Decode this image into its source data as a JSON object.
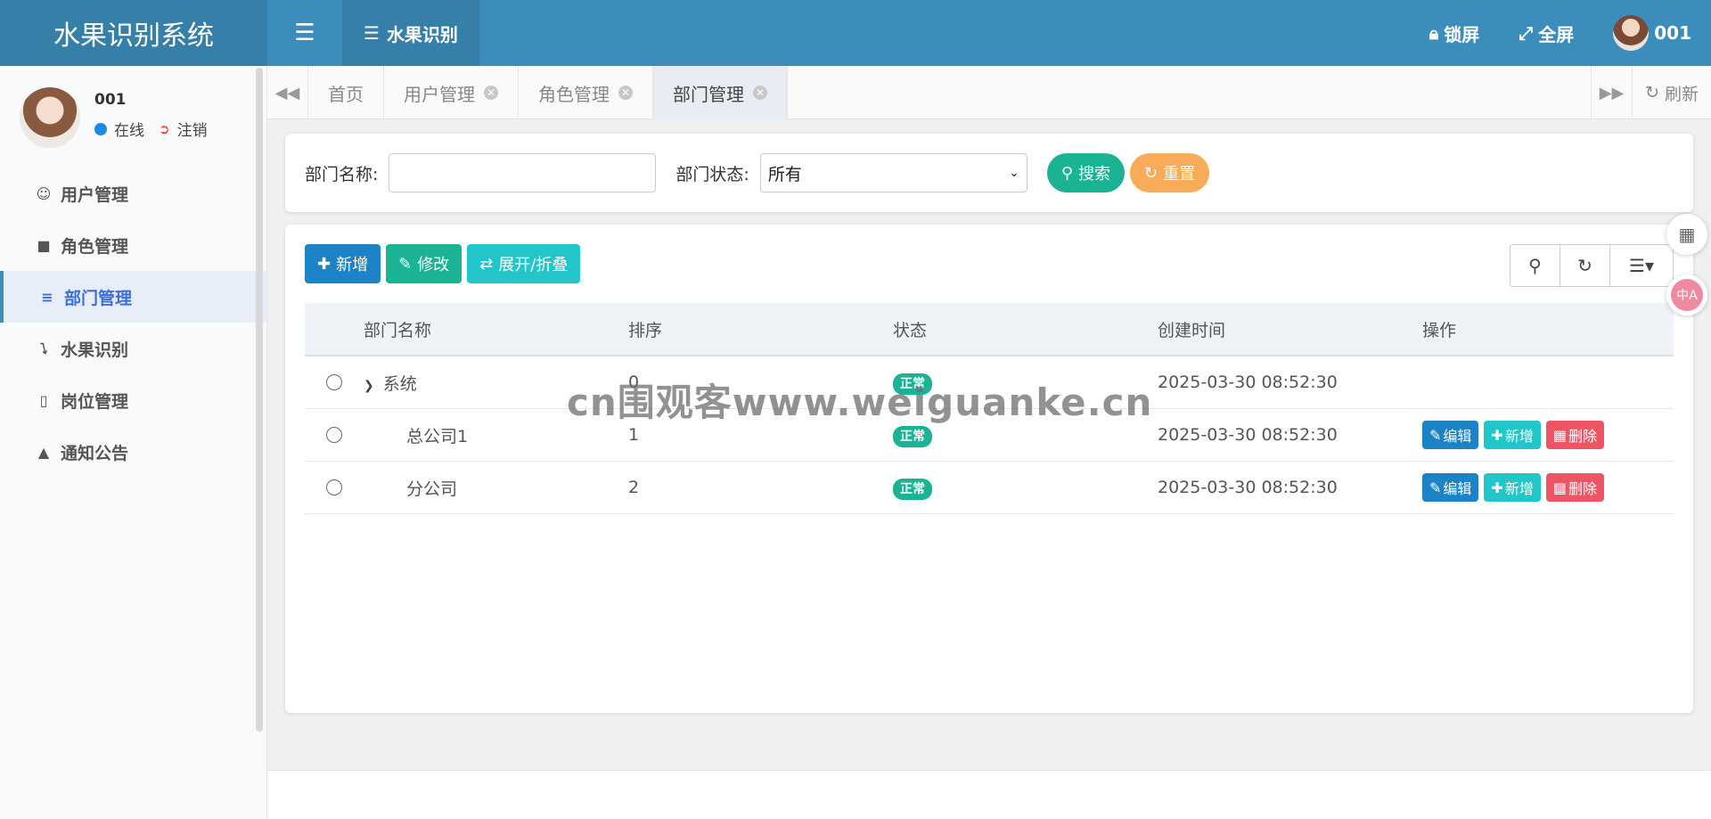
{
  "header": {
    "brand": "水果识别系统",
    "active_nav": "水果识别",
    "lock_label": "锁屏",
    "fullscreen_label": "全屏",
    "user": "001"
  },
  "sidebar": {
    "user_name": "001",
    "status": "在线",
    "logout": "注销",
    "items": [
      {
        "label": "用户管理",
        "icon": "user-icon"
      },
      {
        "label": "角色管理",
        "icon": "role-icon"
      },
      {
        "label": "部门管理",
        "icon": "list-indent-icon"
      },
      {
        "label": "水果识别",
        "icon": "bolt-icon"
      },
      {
        "label": "岗位管理",
        "icon": "id-card-icon"
      },
      {
        "label": "通知公告",
        "icon": "bullhorn-icon"
      }
    ]
  },
  "tabs": {
    "items": [
      {
        "label": "首页"
      },
      {
        "label": "用户管理"
      },
      {
        "label": "角色管理"
      },
      {
        "label": "部门管理"
      }
    ],
    "refresh": "刷新"
  },
  "search": {
    "dept_name_label": "部门名称:",
    "dept_name_value": "",
    "status_label": "部门状态:",
    "status_value": "所有",
    "search_btn": "搜索",
    "reset_btn": "重置"
  },
  "toolbar": {
    "add": "新增",
    "edit": "修改",
    "expand": "展开/折叠"
  },
  "table": {
    "headers": [
      "部门名称",
      "排序",
      "状态",
      "创建时间",
      "操作"
    ],
    "rows": [
      {
        "name": "系统",
        "order": "0",
        "status": "正常",
        "created": "2025-03-30 08:52:30"
      },
      {
        "name": "总公司1",
        "order": "1",
        "status": "正常",
        "created": "2025-03-30 08:52:30"
      },
      {
        "name": "分公司",
        "order": "2",
        "status": "正常",
        "created": "2025-03-30 08:52:30"
      }
    ],
    "actions": {
      "edit": "编辑",
      "add": "新增",
      "delete": "删除"
    }
  },
  "watermark": "cn围观客www.weiguanke.cn",
  "colors": {
    "header": "#3c8dbc",
    "brand": "#367fa9",
    "primary": "#1c84c6",
    "success": "#1ab394",
    "info": "#23c6c8",
    "warning": "#f8ac59",
    "danger": "#ed5565"
  }
}
